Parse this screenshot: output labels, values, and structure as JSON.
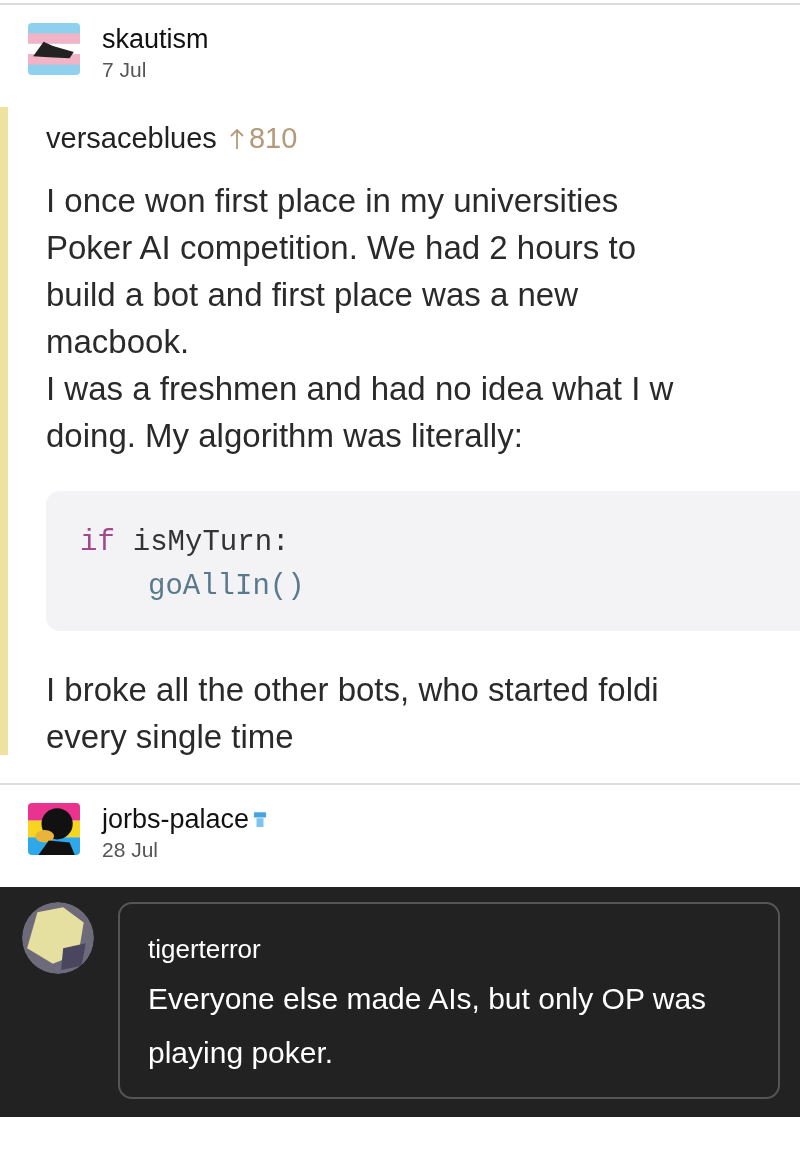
{
  "reblogs": [
    {
      "username": "skautism",
      "date": "7 Jul",
      "verified_badge": false,
      "quote": {
        "username": "versaceblues",
        "notes": "810",
        "paragraphs_before": [
          [
            "I once won first place in my universities",
            "Poker AI competition. We had 2 hours to",
            "build a bot and first place was a new",
            "macbook."
          ],
          [
            "I was a freshmen and had no idea what I w",
            "doing. My algorithm was literally:"
          ]
        ],
        "code": [
          {
            "kind": "keyword_line",
            "keyword": "if",
            "rest": "isMyTurn:"
          },
          {
            "kind": "call_line",
            "text": "goAllIn()"
          }
        ],
        "paragraphs_after": [
          [
            "I broke all the other bots, who started foldi",
            "every single time"
          ]
        ]
      }
    },
    {
      "username": "jorbs-palace",
      "date": "28 Jul",
      "verified_badge": true
    }
  ],
  "comment": {
    "username": "tigerterror",
    "text": "Everyone else made AIs, but only OP was playing poker."
  }
}
